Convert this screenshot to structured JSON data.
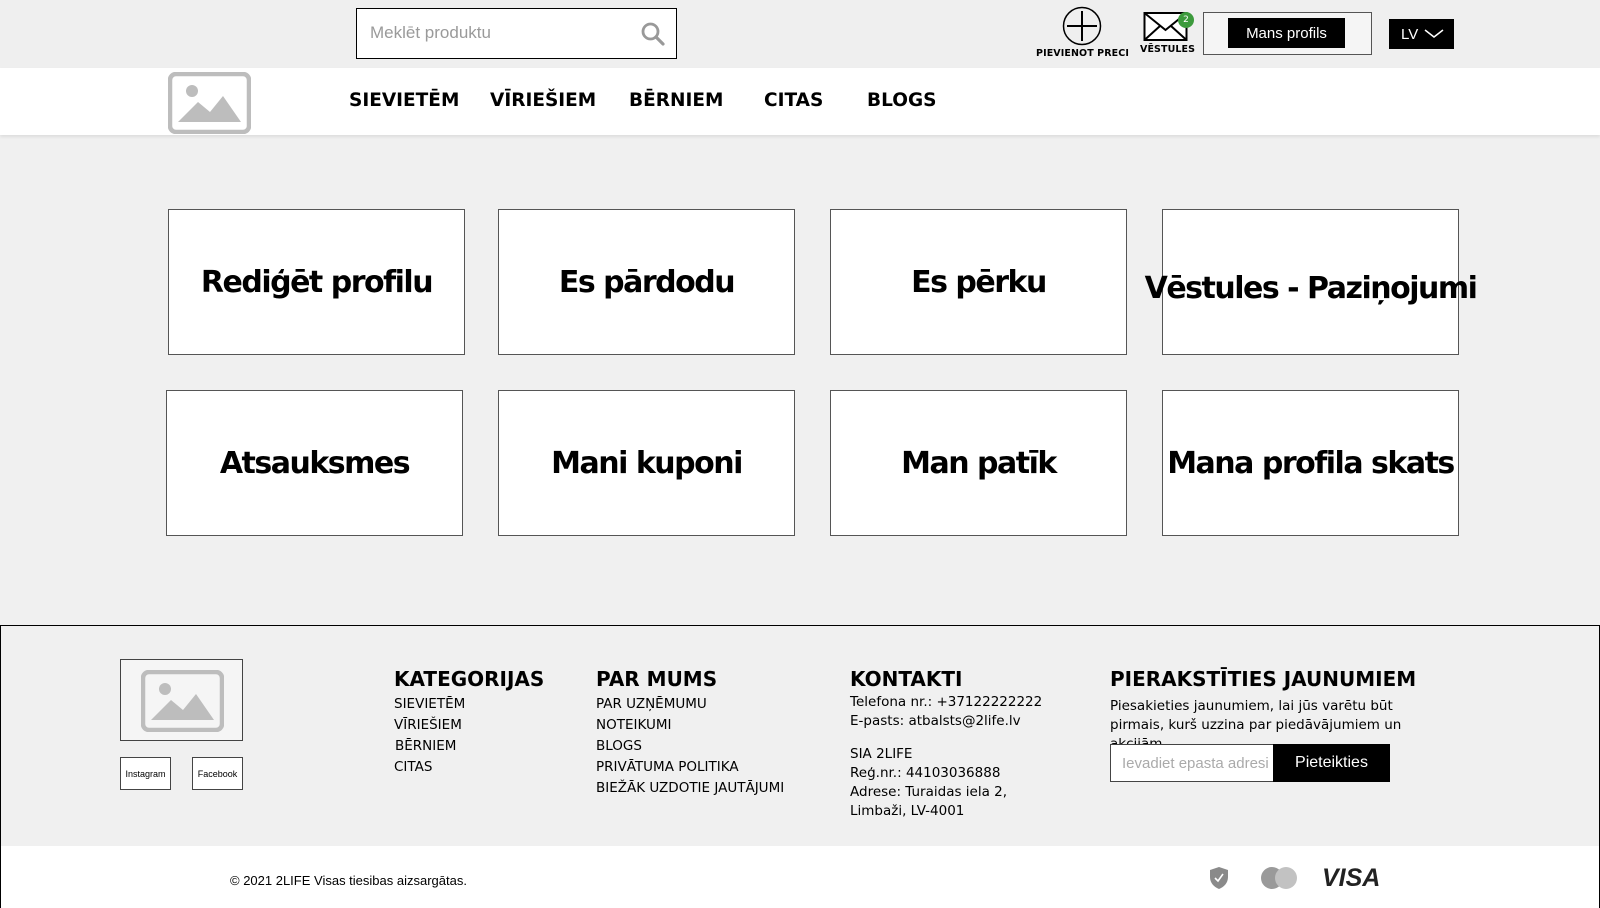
{
  "header": {
    "search_placeholder": "Meklēt produktu",
    "add_item_label": "PIEVIENOT PRECI",
    "messages_label": "VĒSTULES",
    "messages_count": "2",
    "profile_button": "Mans profils",
    "language": "LV"
  },
  "nav": {
    "items": [
      "SIEVIETĒM",
      "VĪRIEŠIEM",
      "BĒRNIEM",
      "CITAS",
      "BLOGS"
    ]
  },
  "cards": [
    "Rediģēt profilu",
    "Es pārdodu",
    "Es pērku",
    "Vēstules - Paziņojumi",
    "Atsauksmes",
    "Mani kuponi",
    "Man patīk",
    "Mana profila skats"
  ],
  "footer": {
    "social": [
      "Instagram",
      "Facebook"
    ],
    "categories": {
      "title": "KATEGORIJAS",
      "links": [
        "SIEVIETĒM",
        "VĪRIEŠIEM",
        "BĒRNIEM",
        "CITAS"
      ]
    },
    "about": {
      "title": "PAR MUMS",
      "links": [
        "PAR UZŅĒMUMU",
        "NOTEIKUMI",
        "BLOGS",
        "PRIVĀTUMA POLITIKA",
        "BIEŽĀK UZDOTIE JAUTĀJUMI"
      ]
    },
    "contacts": {
      "title": "KONTAKTI",
      "phone": "Telefona nr.: +37122222222",
      "email": "E-pasts:  atbalsts@2life.lv",
      "company": "SIA 2LIFE",
      "reg": "Reģ.nr.: 44103036888",
      "address1": "Adrese: Turaidas iela 2,",
      "address2": "Limbaži, LV-4001"
    },
    "newsletter": {
      "title": "PIERAKSTĪTIES JAUNUMIEM",
      "text": "Piesakieties jaunumiem, lai jūs varētu būt pirmais, kurš uzzina par piedāvājumiem un akcijām.",
      "placeholder": "Ievadiet epasta adresi",
      "button": "Pieteikties"
    },
    "copyright": "© 2021 2LIFE Visas tiesibas aizsargātas.",
    "payment_icons": [
      "shield-icon",
      "mastercard-icon",
      "visa-icon"
    ],
    "visa_text": "VISA"
  },
  "colors": {
    "accent": "#000000",
    "badge": "#3c9a3c",
    "background": "#f0f0f0"
  }
}
